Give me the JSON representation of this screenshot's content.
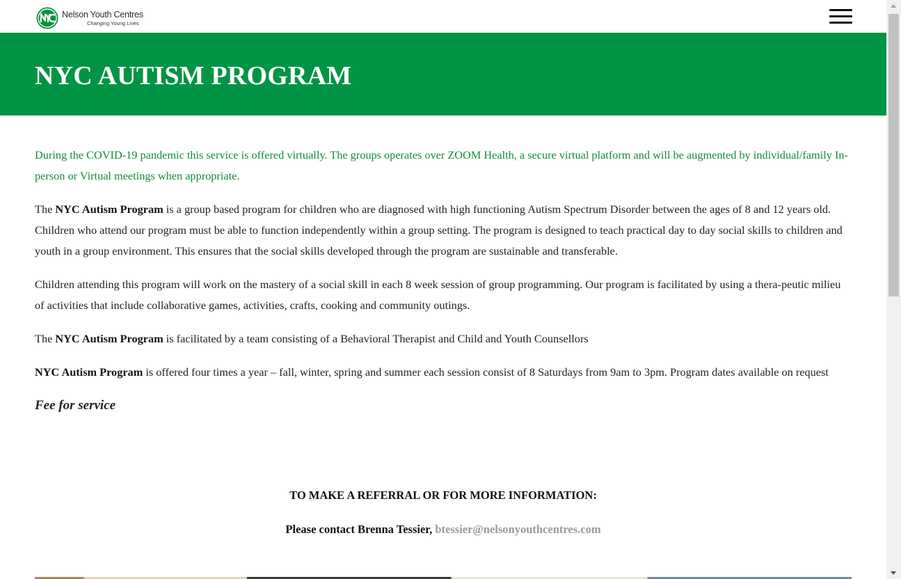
{
  "header": {
    "logo_name": "Nelson Youth Centres",
    "logo_tagline": "Changing Young Lives",
    "menu_icon": "hamburger-menu-icon",
    "logo_icon": "nyc-logo-icon"
  },
  "banner": {
    "title": "NYC AUTISM PROGRAM",
    "background_color": "#009444"
  },
  "content": {
    "covid_notice": "During the COVID-19 pandemic this service is offered virtually. The groups operates over ZOOM Health, a secure virtual platform and will be augmented by individual/family In-person or Virtual meetings when appropriate.",
    "p1_prefix": "The ",
    "program_name": "NYC Autism Program",
    "p1_rest": " is a group based program for children who are diagnosed with high functioning Autism Spectrum Disorder between the ages of 8 and 12 years old. Children who attend our program must be able to function independently within a group setting. The program is designed to teach practical day to day social skills to children and youth in a group environment. This ensures that the social skills developed through the program are sustainable and transferable.",
    "p2": "Children attending this program will work on the mastery of a social skill in each 8 week session of group programming.  Our program is facilitated by using a thera-peutic milieu of activities that include collaborative games, activities, crafts, cooking and community outings.",
    "p3_prefix": "The ",
    "p3_rest": " is facilitated by a team consisting of a Behavioral Therapist and Child and Youth Counsellors",
    "p4_rest": " is offered four times a year – fall, winter, spring and summer each session consist of 8 Saturdays from 9am to 3pm.   Program dates available on request",
    "fee": "Fee for service"
  },
  "cta": {
    "heading": "TO MAKE A REFERRAL OR FOR MORE INFORMATION:",
    "contact_prefix": "Please contact Brenna Tessier, ",
    "email": "btessier@nelsonyouthcentres.com"
  },
  "colors": {
    "brand_green": "#009444",
    "notice_text": "#138a3a",
    "email_link": "#9a9a9a"
  }
}
